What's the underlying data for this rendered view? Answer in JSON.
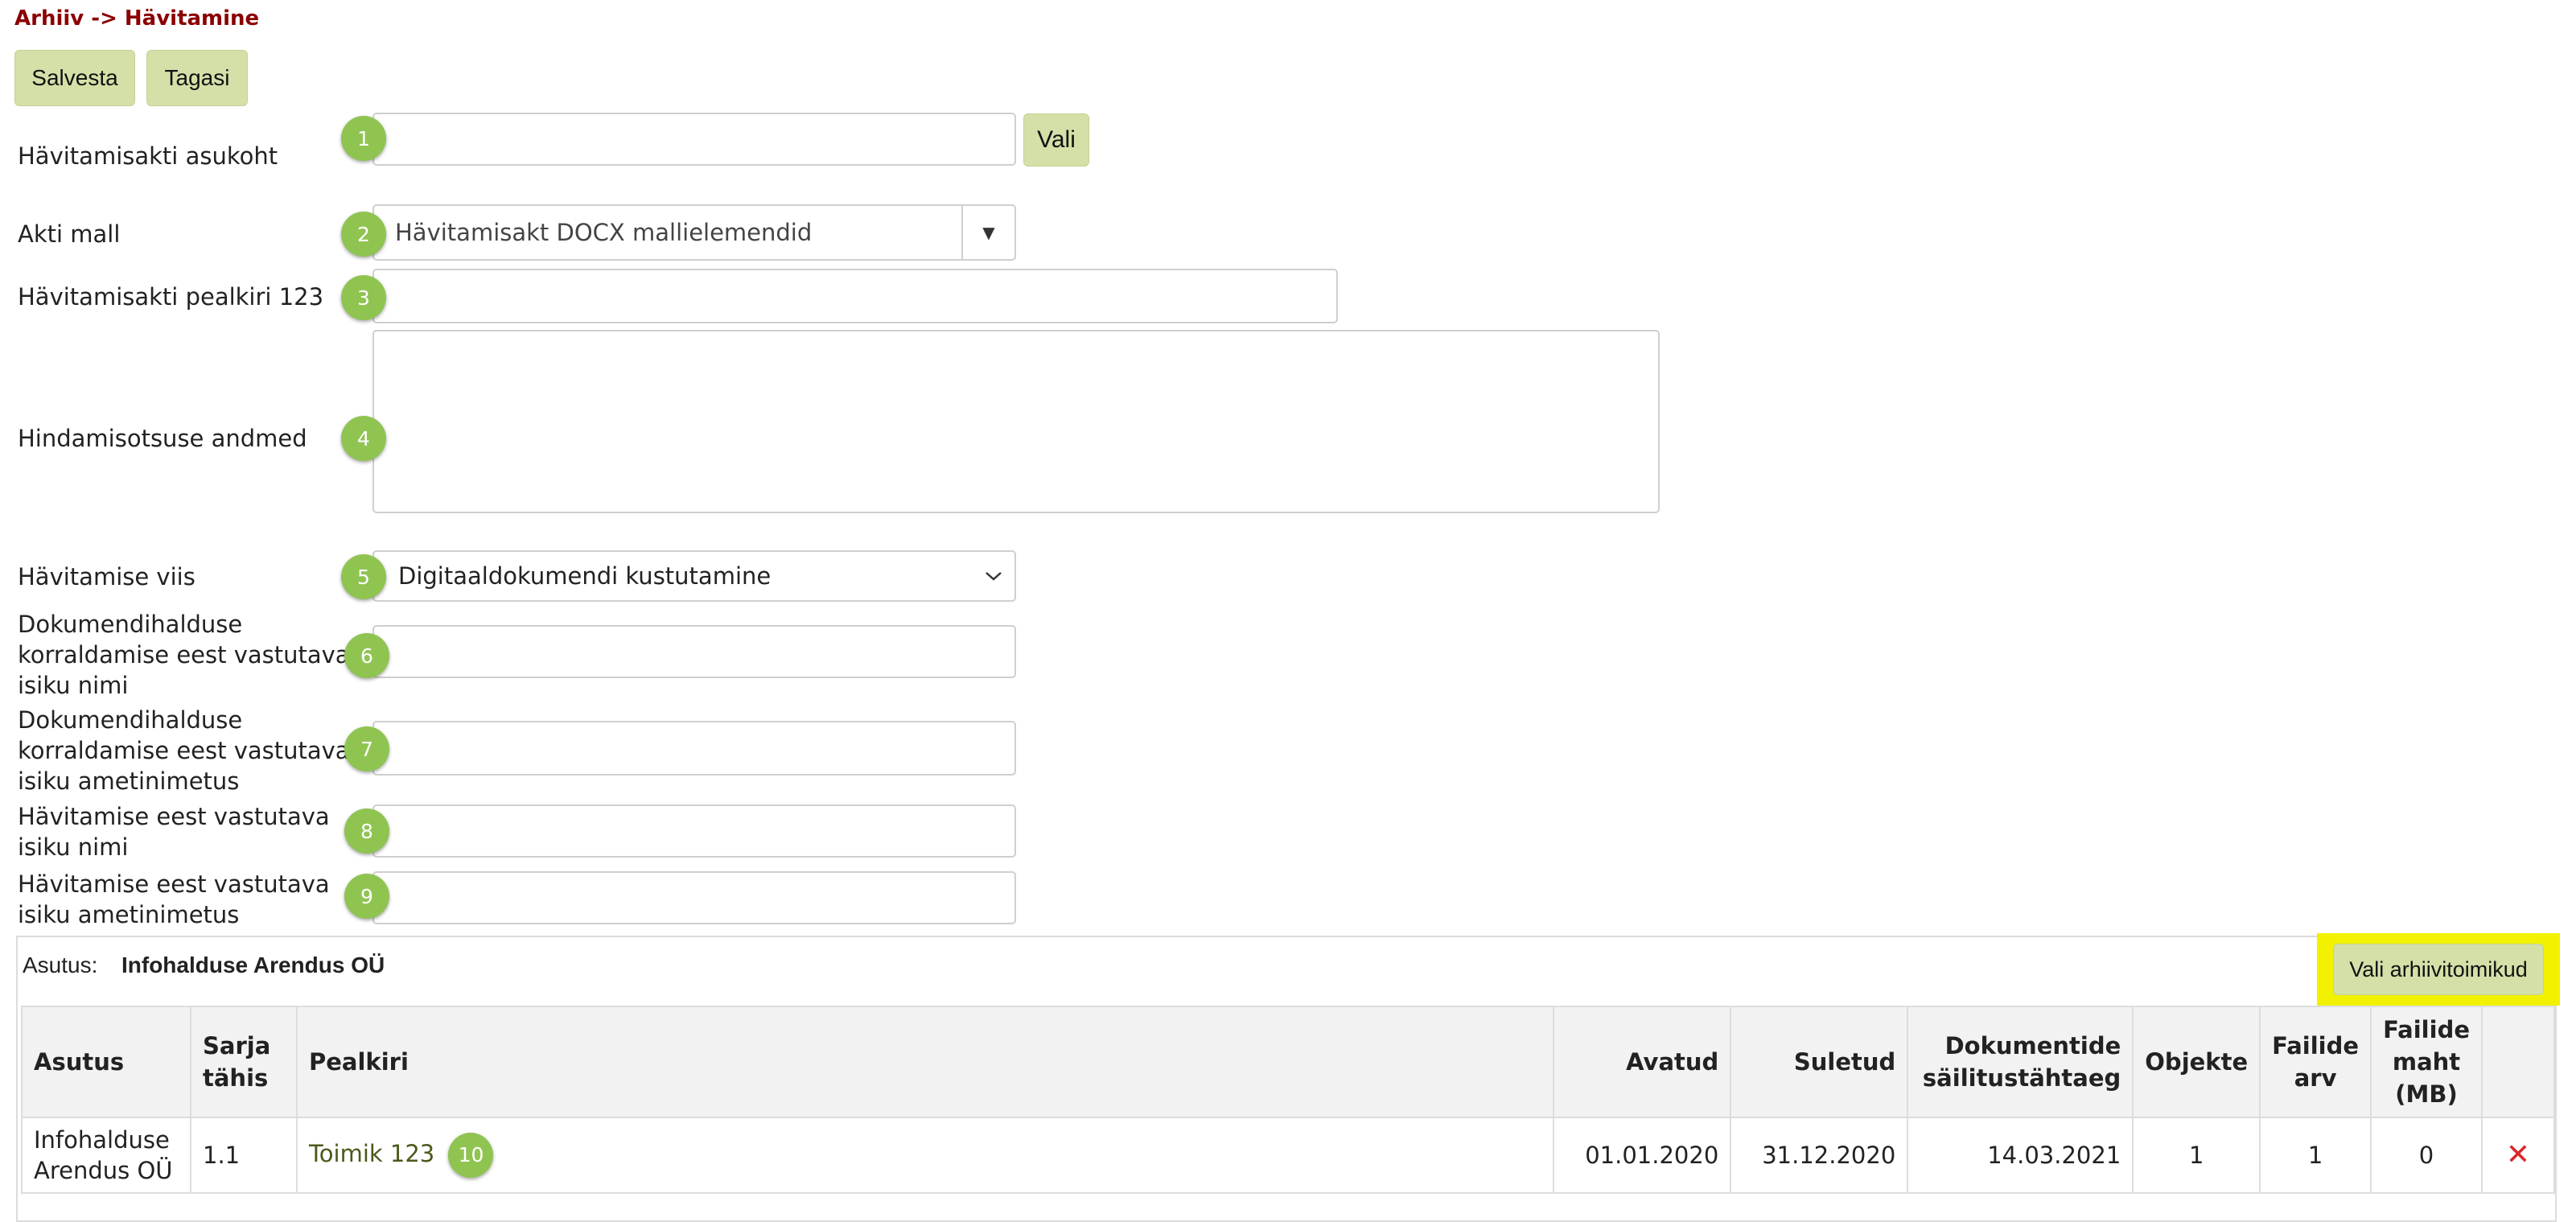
{
  "breadcrumb": "Arhiiv -> Hävitamine",
  "toolbar": {
    "save_label": "Salvesta",
    "back_label": "Tagasi"
  },
  "form": {
    "location": {
      "label": "Hävitamisakti asukoht",
      "value": "",
      "badge": "1",
      "choose_label": "Vali"
    },
    "template": {
      "label": "Akti mall",
      "value": "Hävitamisakt DOCX mallielemendid",
      "badge": "2",
      "toggle_icon": "▼"
    },
    "title": {
      "label": "Hävitamisakti pealkiri 123",
      "value": "",
      "badge": "3"
    },
    "assessment": {
      "label": "Hindamisotsuse andmed",
      "value": "",
      "badge": "4"
    },
    "method": {
      "label": "Hävitamise viis",
      "value": "Digitaaldokumendi kustutamine",
      "badge": "5"
    },
    "records_manager_name": {
      "label_lines": [
        "Dokumendihalduse",
        "korraldamise eest vastutava",
        "isiku nimi"
      ],
      "value": "",
      "badge": "6"
    },
    "records_manager_title": {
      "label_lines": [
        "Dokumendihalduse",
        "korraldamise eest vastutava",
        "isiku ametinimetus"
      ],
      "value": "",
      "badge": "7"
    },
    "destruction_person_name": {
      "label_lines": [
        "Hävitamise eest vastutava",
        "isiku nimi"
      ],
      "value": "",
      "badge": "8"
    },
    "destruction_person_title": {
      "label_lines": [
        "Hävitamise eest vastutava",
        "isiku ametinimetus"
      ],
      "value": "",
      "badge": "9"
    }
  },
  "institution": {
    "label": "Asutus:",
    "name": "Infohalduse Arendus OÜ",
    "select_button": "Vali arhiivitoimikud",
    "highlight_color": "#f2f200"
  },
  "table": {
    "headers": {
      "institution": "Asutus",
      "series_lines": [
        "Sarja",
        "tähis"
      ],
      "title": "Pealkiri",
      "opened": "Avatud",
      "closed": "Suletud",
      "retention_lines": [
        "Dokumentide",
        "säilitustähtaeg"
      ],
      "objects": "Objekte",
      "file_count_lines": [
        "Failide",
        "arv"
      ],
      "file_size_lines": [
        "Failide",
        "maht",
        "(MB)"
      ]
    },
    "rows": [
      {
        "institution_lines": [
          "Infohalduse",
          "Arendus OÜ"
        ],
        "series": "1.1",
        "title": "Toimik 123",
        "badge": "10",
        "opened": "01.01.2020",
        "closed": "31.12.2020",
        "retention": "14.03.2021",
        "objects": "1",
        "file_count": "1",
        "file_size": "0",
        "delete_icon": "✕"
      }
    ]
  },
  "colors": {
    "button_bg": "#d4e0a8",
    "badge_bg": "#8fc451",
    "breadcrumb": "#8b0000",
    "delete": "#d9262c"
  }
}
